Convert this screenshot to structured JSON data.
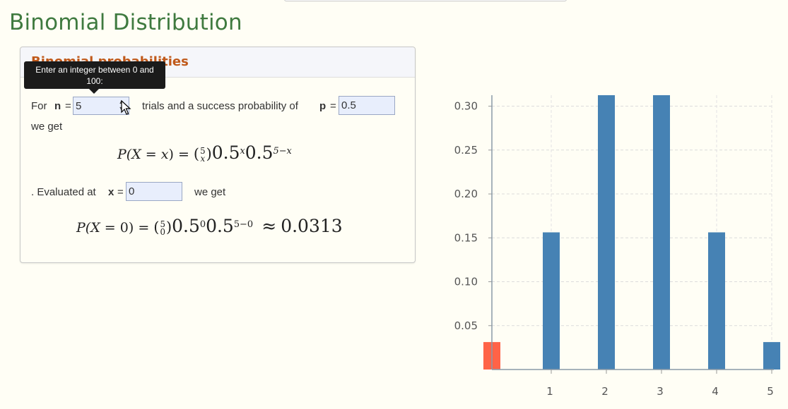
{
  "page": {
    "title": "Binomial Distribution"
  },
  "card": {
    "title": "Binomial probabilities",
    "tooltip": "Enter an integer between 0 and 100:",
    "for_label": "For",
    "n_label": "n",
    "equals": "=",
    "n_value": "5",
    "trials_text": "trials and a success probability of",
    "p_label": "p",
    "p_value": "0.5",
    "we_get_1": "we get",
    "evaluated_text": ". Evaluated at",
    "x_label": "x",
    "x_value": "0",
    "we_get_2": "we get",
    "formula_general": {
      "lhs": "P(X",
      "var": "x",
      "rparen": ")",
      "eq": "=",
      "binom_top": "5",
      "binom_bottom": "x",
      "base1": "0.5",
      "exp1": "x",
      "base2": "0.5",
      "exp2": "5−x"
    },
    "formula_evaluated": {
      "lhs": "P(X",
      "var": "0",
      "rparen": ")",
      "eq": "=",
      "binom_top": "5",
      "binom_bottom": "0",
      "base1": "0.5",
      "exp1": "0",
      "base2": "0.5",
      "exp2": "5−0",
      "approx": "≈",
      "result": "0.0313"
    }
  },
  "icons": {
    "spinner": "spinner-arrows-icon",
    "cursor": "mouse-pointer-icon"
  },
  "chart_data": {
    "type": "bar",
    "x": [
      0,
      1,
      2,
      3,
      4,
      5
    ],
    "values": [
      0.03125,
      0.15625,
      0.3125,
      0.3125,
      0.15625,
      0.03125
    ],
    "highlight_index": 0,
    "bar_color": "#4682b4",
    "highlight_color": "#ff6347",
    "xticks": [
      "1",
      "2",
      "3",
      "4",
      "5"
    ],
    "yticks": [
      "0.05",
      "0.10",
      "0.15",
      "0.20",
      "0.25",
      "0.30"
    ],
    "ylim": [
      0,
      0.3125
    ],
    "grid": true
  }
}
